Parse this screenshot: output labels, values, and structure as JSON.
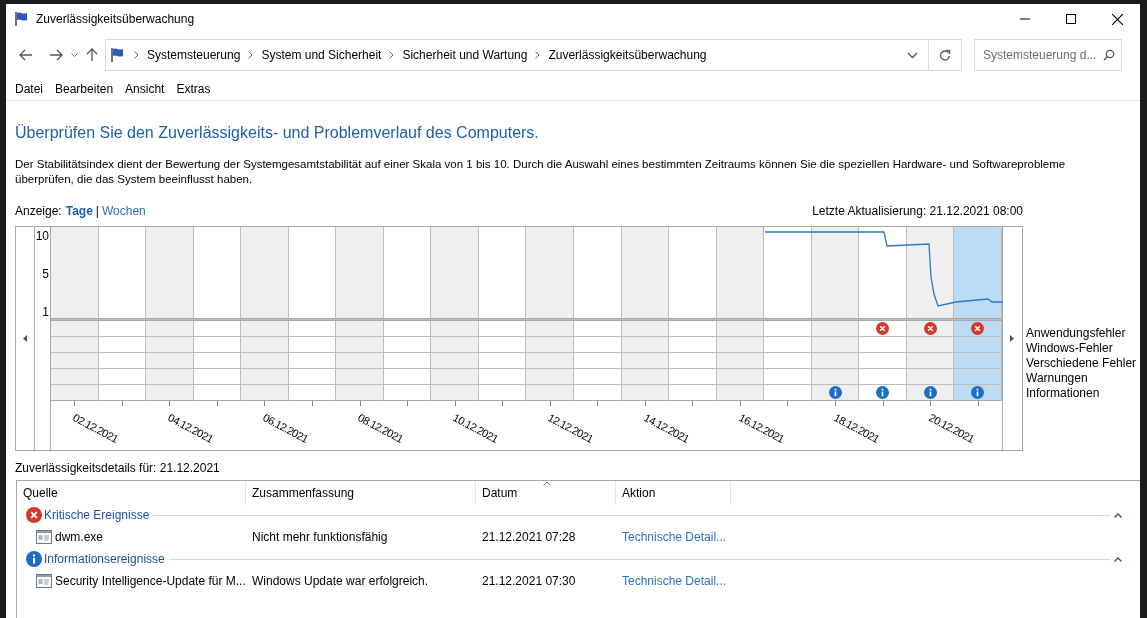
{
  "window": {
    "title": "Zuverlässigkeitsüberwachung"
  },
  "breadcrumbs": [
    "Systemsteuerung",
    "System und Sicherheit",
    "Sicherheit und Wartung",
    "Zuverlässigkeitsüberwachung"
  ],
  "search": {
    "placeholder": "Systemsteuerung d..."
  },
  "menu": [
    "Datei",
    "Bearbeiten",
    "Ansicht",
    "Extras"
  ],
  "heading": "Überprüfen Sie den Zuverlässigkeits- und Problemverlauf des Computers.",
  "description": "Der Stabilitätsindex dient der Bewertung der Systemgesamtstabilität auf einer Skala von 1 bis 10. Durch die Auswahl eines bestimmten Zeitraums können Sie die speziellen Hardware- und Softwareprobleme überprüfen, die das System beeinflusst haben.",
  "view": {
    "label": "Anzeige:",
    "separator": "|",
    "options": [
      {
        "label": "Tage",
        "selected": true
      },
      {
        "label": "Wochen",
        "selected": false
      }
    ]
  },
  "last_update": "Letzte Aktualisierung: 21.12.2021 08:00",
  "chart": {
    "y_ticks": [
      "10",
      "5",
      "1"
    ],
    "legend": [
      "Anwendungsfehler",
      "Windows-Fehler",
      "Verschiedene Fehler",
      "Warnungen",
      "Informationen"
    ],
    "days": [
      {
        "label": "02.12.2021",
        "selected": false,
        "app_error": false,
        "windows_error": false,
        "misc_error": false,
        "warning": false,
        "info": false
      },
      {
        "selected": false,
        "app_error": false,
        "windows_error": false,
        "misc_error": false,
        "warning": false,
        "info": false
      },
      {
        "label": "04.12.2021",
        "selected": false,
        "app_error": false,
        "windows_error": false,
        "misc_error": false,
        "warning": false,
        "info": false
      },
      {
        "selected": false,
        "app_error": false,
        "windows_error": false,
        "misc_error": false,
        "warning": false,
        "info": false
      },
      {
        "label": "06.12.2021",
        "selected": false,
        "app_error": false,
        "windows_error": false,
        "misc_error": false,
        "warning": false,
        "info": false
      },
      {
        "selected": false,
        "app_error": false,
        "windows_error": false,
        "misc_error": false,
        "warning": false,
        "info": false
      },
      {
        "label": "08.12.2021",
        "selected": false,
        "app_error": false,
        "windows_error": false,
        "misc_error": false,
        "warning": false,
        "info": false
      },
      {
        "selected": false,
        "app_error": false,
        "windows_error": false,
        "misc_error": false,
        "warning": false,
        "info": false
      },
      {
        "label": "10.12.2021",
        "selected": false,
        "app_error": false,
        "windows_error": false,
        "misc_error": false,
        "warning": false,
        "info": false
      },
      {
        "selected": false,
        "app_error": false,
        "windows_error": false,
        "misc_error": false,
        "warning": false,
        "info": false
      },
      {
        "label": "12.12.2021",
        "selected": false,
        "app_error": false,
        "windows_error": false,
        "misc_error": false,
        "warning": false,
        "info": false
      },
      {
        "selected": false,
        "app_error": false,
        "windows_error": false,
        "misc_error": false,
        "warning": false,
        "info": false
      },
      {
        "label": "14.12.2021",
        "selected": false,
        "app_error": false,
        "windows_error": false,
        "misc_error": false,
        "warning": false,
        "info": false
      },
      {
        "selected": false,
        "app_error": false,
        "windows_error": false,
        "misc_error": false,
        "warning": false,
        "info": false
      },
      {
        "label": "16.12.2021",
        "selected": false,
        "app_error": false,
        "windows_error": false,
        "misc_error": false,
        "warning": false,
        "info": false
      },
      {
        "selected": false,
        "app_error": false,
        "windows_error": false,
        "misc_error": false,
        "warning": false,
        "info": false
      },
      {
        "label": "18.12.2021",
        "selected": false,
        "app_error": false,
        "windows_error": false,
        "misc_error": false,
        "warning": false,
        "info": true
      },
      {
        "selected": false,
        "app_error": true,
        "windows_error": false,
        "misc_error": false,
        "warning": false,
        "info": true
      },
      {
        "label": "20.12.2021",
        "selected": false,
        "app_error": true,
        "windows_error": false,
        "misc_error": false,
        "warning": false,
        "info": true
      },
      {
        "selected": true,
        "app_error": true,
        "windows_error": false,
        "misc_error": false,
        "warning": false,
        "info": true
      }
    ]
  },
  "details": {
    "title": "Zuverlässigkeitsdetails für: 21.12.2021",
    "columns": [
      {
        "label": "Quelle",
        "sorted": false
      },
      {
        "label": "Zusammenfassung",
        "sorted": false
      },
      {
        "label": "Datum",
        "sorted": true
      },
      {
        "label": "Aktion",
        "sorted": false
      }
    ],
    "groups": [
      {
        "kind": "critical",
        "title": "Kritische Ereignisse",
        "expanded": true,
        "rows": [
          {
            "source": "dwm.exe",
            "summary": "Nicht mehr funktionsfähig",
            "date": "21.12.2021 07:28",
            "action": "Technische Detail..."
          }
        ]
      },
      {
        "kind": "info",
        "title": "Informationsereignisse",
        "expanded": true,
        "rows": [
          {
            "source": "Security Intelligence-Update für M...",
            "summary": "Windows Update war erfolgreich.",
            "date": "21.12.2021 07:30",
            "action": "Technische Detail..."
          }
        ]
      }
    ]
  }
}
